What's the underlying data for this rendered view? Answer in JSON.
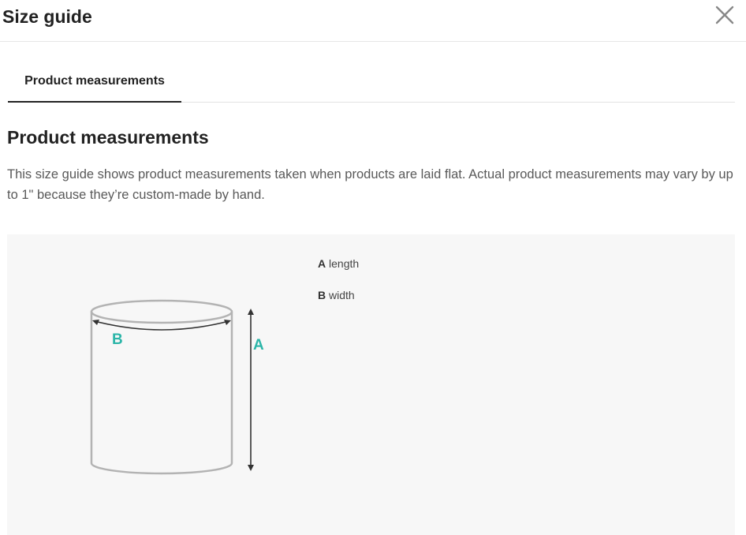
{
  "header": {
    "title": "Size guide",
    "close_icon": "close-icon"
  },
  "tabs": [
    {
      "label": "Product measurements",
      "active": true
    }
  ],
  "content": {
    "heading": "Product measurements",
    "description": "This size guide shows product measurements taken when products are laid flat. Actual product measurements may vary by up to 1\" because they’re custom-made by hand."
  },
  "diagram": {
    "label_a": "A",
    "label_b": "B",
    "accent_color": "#2bb5a8"
  },
  "legend": [
    {
      "key": "A",
      "label": "length"
    },
    {
      "key": "B",
      "label": "width"
    }
  ]
}
